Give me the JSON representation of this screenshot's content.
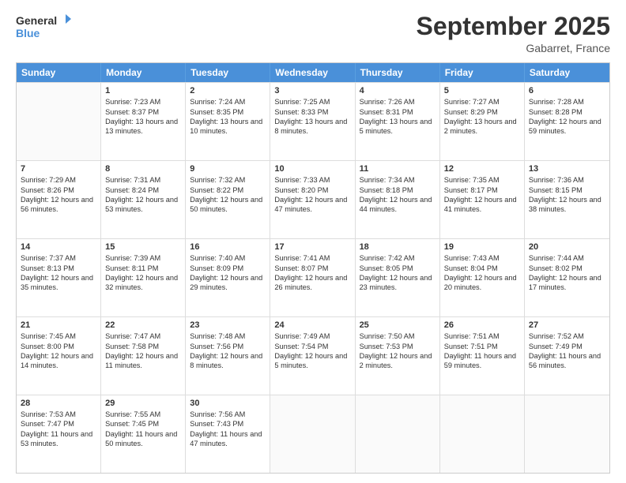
{
  "logo": {
    "line1": "General",
    "line2": "Blue"
  },
  "title": "September 2025",
  "subtitle": "Gabarret, France",
  "header_days": [
    "Sunday",
    "Monday",
    "Tuesday",
    "Wednesday",
    "Thursday",
    "Friday",
    "Saturday"
  ],
  "weeks": [
    [
      {
        "day": "",
        "sunrise": "",
        "sunset": "",
        "daylight": ""
      },
      {
        "day": "1",
        "sunrise": "Sunrise: 7:23 AM",
        "sunset": "Sunset: 8:37 PM",
        "daylight": "Daylight: 13 hours and 13 minutes."
      },
      {
        "day": "2",
        "sunrise": "Sunrise: 7:24 AM",
        "sunset": "Sunset: 8:35 PM",
        "daylight": "Daylight: 13 hours and 10 minutes."
      },
      {
        "day": "3",
        "sunrise": "Sunrise: 7:25 AM",
        "sunset": "Sunset: 8:33 PM",
        "daylight": "Daylight: 13 hours and 8 minutes."
      },
      {
        "day": "4",
        "sunrise": "Sunrise: 7:26 AM",
        "sunset": "Sunset: 8:31 PM",
        "daylight": "Daylight: 13 hours and 5 minutes."
      },
      {
        "day": "5",
        "sunrise": "Sunrise: 7:27 AM",
        "sunset": "Sunset: 8:29 PM",
        "daylight": "Daylight: 13 hours and 2 minutes."
      },
      {
        "day": "6",
        "sunrise": "Sunrise: 7:28 AM",
        "sunset": "Sunset: 8:28 PM",
        "daylight": "Daylight: 12 hours and 59 minutes."
      }
    ],
    [
      {
        "day": "7",
        "sunrise": "Sunrise: 7:29 AM",
        "sunset": "Sunset: 8:26 PM",
        "daylight": "Daylight: 12 hours and 56 minutes."
      },
      {
        "day": "8",
        "sunrise": "Sunrise: 7:31 AM",
        "sunset": "Sunset: 8:24 PM",
        "daylight": "Daylight: 12 hours and 53 minutes."
      },
      {
        "day": "9",
        "sunrise": "Sunrise: 7:32 AM",
        "sunset": "Sunset: 8:22 PM",
        "daylight": "Daylight: 12 hours and 50 minutes."
      },
      {
        "day": "10",
        "sunrise": "Sunrise: 7:33 AM",
        "sunset": "Sunset: 8:20 PM",
        "daylight": "Daylight: 12 hours and 47 minutes."
      },
      {
        "day": "11",
        "sunrise": "Sunrise: 7:34 AM",
        "sunset": "Sunset: 8:18 PM",
        "daylight": "Daylight: 12 hours and 44 minutes."
      },
      {
        "day": "12",
        "sunrise": "Sunrise: 7:35 AM",
        "sunset": "Sunset: 8:17 PM",
        "daylight": "Daylight: 12 hours and 41 minutes."
      },
      {
        "day": "13",
        "sunrise": "Sunrise: 7:36 AM",
        "sunset": "Sunset: 8:15 PM",
        "daylight": "Daylight: 12 hours and 38 minutes."
      }
    ],
    [
      {
        "day": "14",
        "sunrise": "Sunrise: 7:37 AM",
        "sunset": "Sunset: 8:13 PM",
        "daylight": "Daylight: 12 hours and 35 minutes."
      },
      {
        "day": "15",
        "sunrise": "Sunrise: 7:39 AM",
        "sunset": "Sunset: 8:11 PM",
        "daylight": "Daylight: 12 hours and 32 minutes."
      },
      {
        "day": "16",
        "sunrise": "Sunrise: 7:40 AM",
        "sunset": "Sunset: 8:09 PM",
        "daylight": "Daylight: 12 hours and 29 minutes."
      },
      {
        "day": "17",
        "sunrise": "Sunrise: 7:41 AM",
        "sunset": "Sunset: 8:07 PM",
        "daylight": "Daylight: 12 hours and 26 minutes."
      },
      {
        "day": "18",
        "sunrise": "Sunrise: 7:42 AM",
        "sunset": "Sunset: 8:05 PM",
        "daylight": "Daylight: 12 hours and 23 minutes."
      },
      {
        "day": "19",
        "sunrise": "Sunrise: 7:43 AM",
        "sunset": "Sunset: 8:04 PM",
        "daylight": "Daylight: 12 hours and 20 minutes."
      },
      {
        "day": "20",
        "sunrise": "Sunrise: 7:44 AM",
        "sunset": "Sunset: 8:02 PM",
        "daylight": "Daylight: 12 hours and 17 minutes."
      }
    ],
    [
      {
        "day": "21",
        "sunrise": "Sunrise: 7:45 AM",
        "sunset": "Sunset: 8:00 PM",
        "daylight": "Daylight: 12 hours and 14 minutes."
      },
      {
        "day": "22",
        "sunrise": "Sunrise: 7:47 AM",
        "sunset": "Sunset: 7:58 PM",
        "daylight": "Daylight: 12 hours and 11 minutes."
      },
      {
        "day": "23",
        "sunrise": "Sunrise: 7:48 AM",
        "sunset": "Sunset: 7:56 PM",
        "daylight": "Daylight: 12 hours and 8 minutes."
      },
      {
        "day": "24",
        "sunrise": "Sunrise: 7:49 AM",
        "sunset": "Sunset: 7:54 PM",
        "daylight": "Daylight: 12 hours and 5 minutes."
      },
      {
        "day": "25",
        "sunrise": "Sunrise: 7:50 AM",
        "sunset": "Sunset: 7:53 PM",
        "daylight": "Daylight: 12 hours and 2 minutes."
      },
      {
        "day": "26",
        "sunrise": "Sunrise: 7:51 AM",
        "sunset": "Sunset: 7:51 PM",
        "daylight": "Daylight: 11 hours and 59 minutes."
      },
      {
        "day": "27",
        "sunrise": "Sunrise: 7:52 AM",
        "sunset": "Sunset: 7:49 PM",
        "daylight": "Daylight: 11 hours and 56 minutes."
      }
    ],
    [
      {
        "day": "28",
        "sunrise": "Sunrise: 7:53 AM",
        "sunset": "Sunset: 7:47 PM",
        "daylight": "Daylight: 11 hours and 53 minutes."
      },
      {
        "day": "29",
        "sunrise": "Sunrise: 7:55 AM",
        "sunset": "Sunset: 7:45 PM",
        "daylight": "Daylight: 11 hours and 50 minutes."
      },
      {
        "day": "30",
        "sunrise": "Sunrise: 7:56 AM",
        "sunset": "Sunset: 7:43 PM",
        "daylight": "Daylight: 11 hours and 47 minutes."
      },
      {
        "day": "",
        "sunrise": "",
        "sunset": "",
        "daylight": ""
      },
      {
        "day": "",
        "sunrise": "",
        "sunset": "",
        "daylight": ""
      },
      {
        "day": "",
        "sunrise": "",
        "sunset": "",
        "daylight": ""
      },
      {
        "day": "",
        "sunrise": "",
        "sunset": "",
        "daylight": ""
      }
    ]
  ]
}
